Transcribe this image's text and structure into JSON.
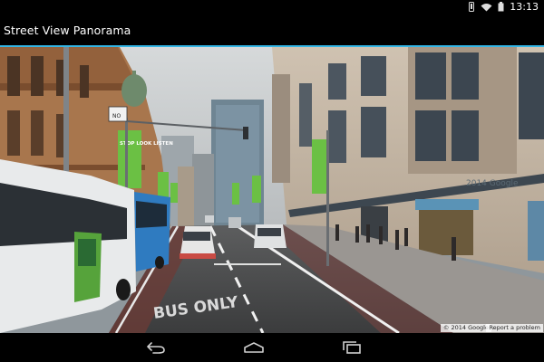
{
  "status_bar": {
    "time": "13:13",
    "icons": [
      "vibrate-icon",
      "wifi-icon",
      "battery-icon"
    ]
  },
  "app": {
    "title": "Street View Panorama",
    "accent_color": "#33b5e5"
  },
  "panorama": {
    "banner_text": "STOP LOOK LISTEN",
    "storefront_text": "2014 Google",
    "road_marking": "BUS ONLY",
    "street_sign": "NO"
  },
  "attribution": {
    "copyright": "© 2014 Google",
    "report": "Report a problem"
  },
  "nav_bar": {
    "buttons": [
      "back-icon",
      "home-icon",
      "recent-apps-icon"
    ]
  }
}
